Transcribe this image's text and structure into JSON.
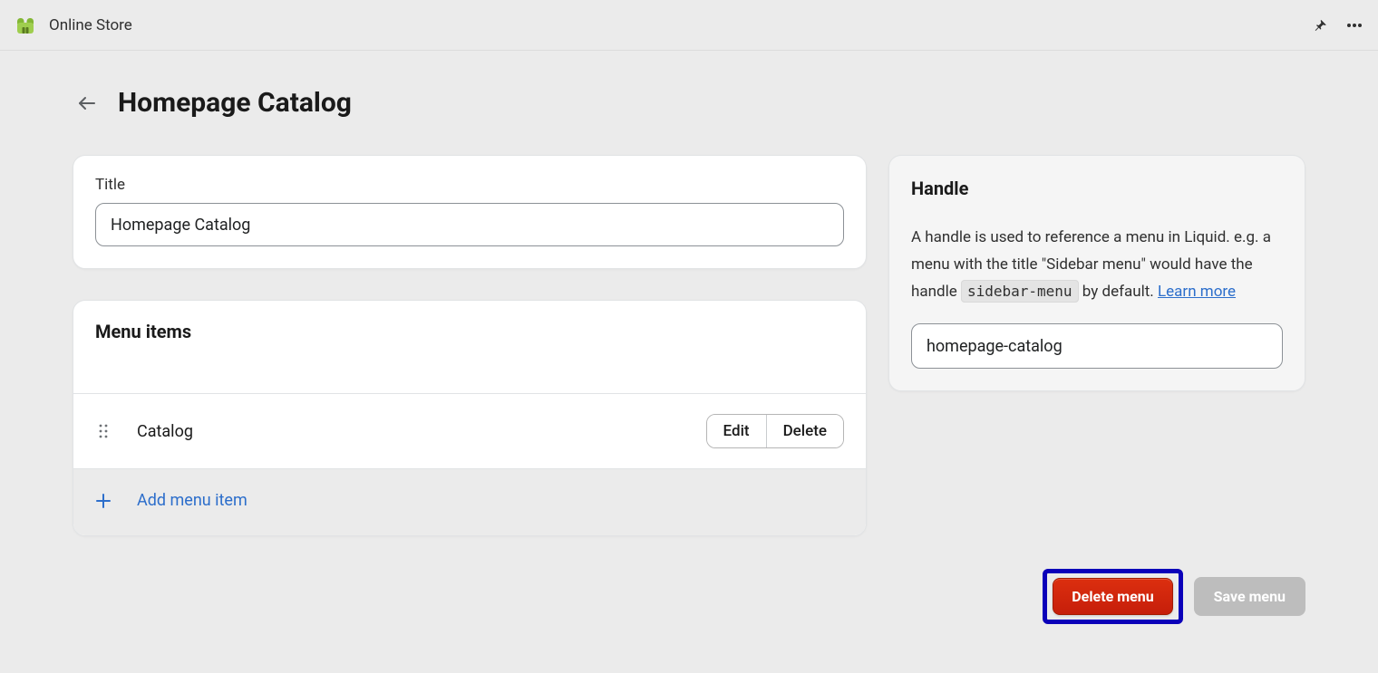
{
  "topbar": {
    "app_title": "Online Store"
  },
  "header": {
    "page_title": "Homepage Catalog"
  },
  "title_card": {
    "label": "Title",
    "value": "Homepage Catalog"
  },
  "menu_card": {
    "section_title": "Menu items",
    "items": [
      {
        "label": "Catalog"
      }
    ],
    "edit_label": "Edit",
    "delete_label": "Delete",
    "add_label": "Add menu item"
  },
  "handle_card": {
    "title": "Handle",
    "desc_pre": "A handle is used to reference a menu in Liquid. e.g. a menu with the title \"Sidebar menu\" would have the handle ",
    "desc_code": "sidebar-menu",
    "desc_post": " by default. ",
    "learn_more": "Learn more",
    "value": "homepage-catalog"
  },
  "footer": {
    "delete_label": "Delete menu",
    "save_label": "Save menu"
  }
}
